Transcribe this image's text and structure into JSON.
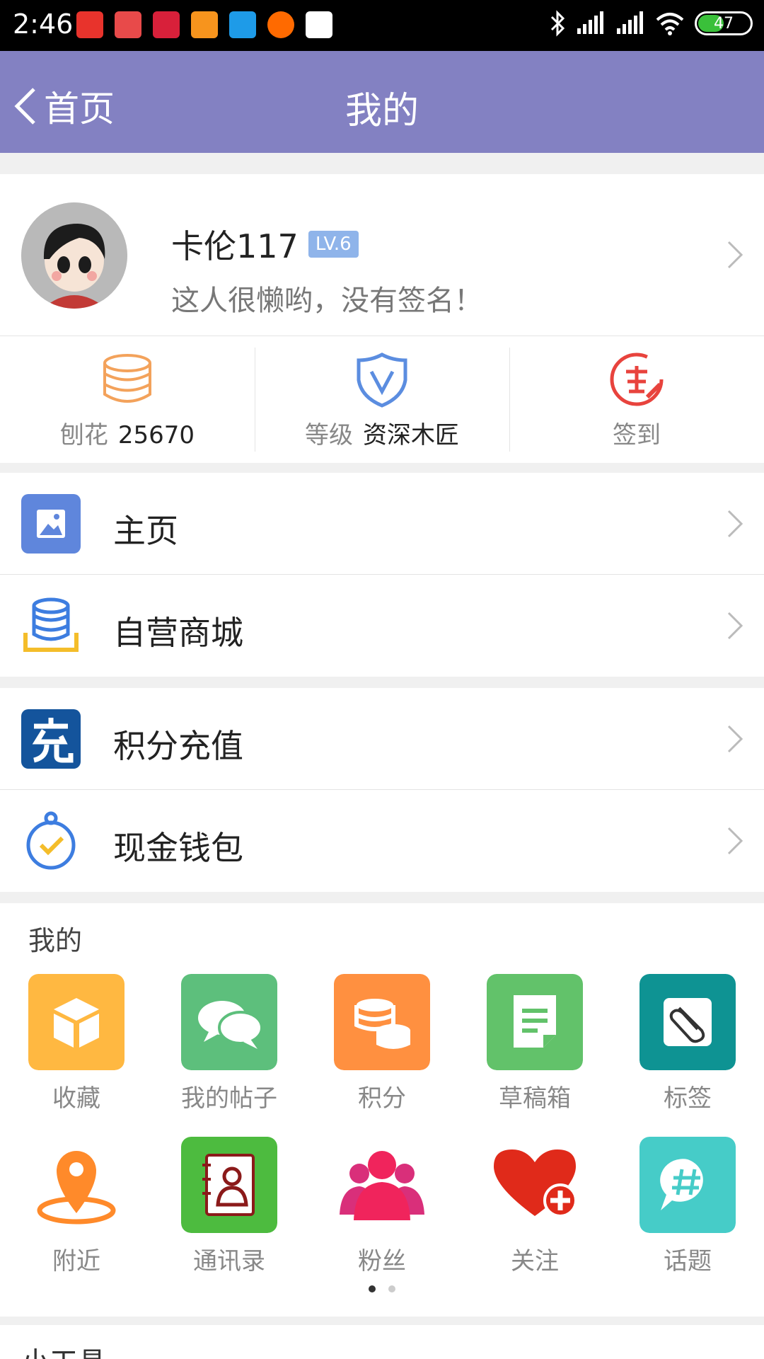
{
  "status_bar": {
    "time": "2:46",
    "battery": "47",
    "battery_level_percent": 47
  },
  "nav": {
    "back_label": "首页",
    "title": "我的"
  },
  "profile": {
    "username": "卡伦117",
    "level_badge": "LV.6",
    "signature": "这人很懒哟，没有签名！"
  },
  "stats": {
    "shavings_label": "刨花",
    "shavings_value": "25670",
    "level_label": "等级",
    "level_value": "资深木匠",
    "checkin_label": "签到"
  },
  "menu": {
    "homepage": "主页",
    "mall": "自营商城",
    "recharge": "积分充值",
    "wallet": "现金钱包"
  },
  "mine": {
    "title": "我的",
    "items": [
      {
        "label": "收藏",
        "icon": "box-icon",
        "color": "#ffb841"
      },
      {
        "label": "我的帖子",
        "icon": "chat-bubbles-icon",
        "color": "#5dbf7c"
      },
      {
        "label": "积分",
        "icon": "coins-icon",
        "color": "#ff9040"
      },
      {
        "label": "草稿箱",
        "icon": "document-icon",
        "color": "#62c26a"
      },
      {
        "label": "标签",
        "icon": "paperclip-icon",
        "color": "#0e9393"
      },
      {
        "label": "附近",
        "icon": "location-pin-icon",
        "color": "#ff8a2a"
      },
      {
        "label": "通讯录",
        "icon": "address-book-icon",
        "color": "#4dbb3f"
      },
      {
        "label": "粉丝",
        "icon": "people-icon",
        "color": "#f0245c"
      },
      {
        "label": "关注",
        "icon": "heart-plus-icon",
        "color": "#e02a1a"
      },
      {
        "label": "话题",
        "icon": "hashtag-icon",
        "color": "#46ccc8"
      }
    ]
  },
  "tools": {
    "title": "小工具"
  },
  "colors": {
    "header": "#8381c2",
    "badge": "#8fb4ea"
  }
}
